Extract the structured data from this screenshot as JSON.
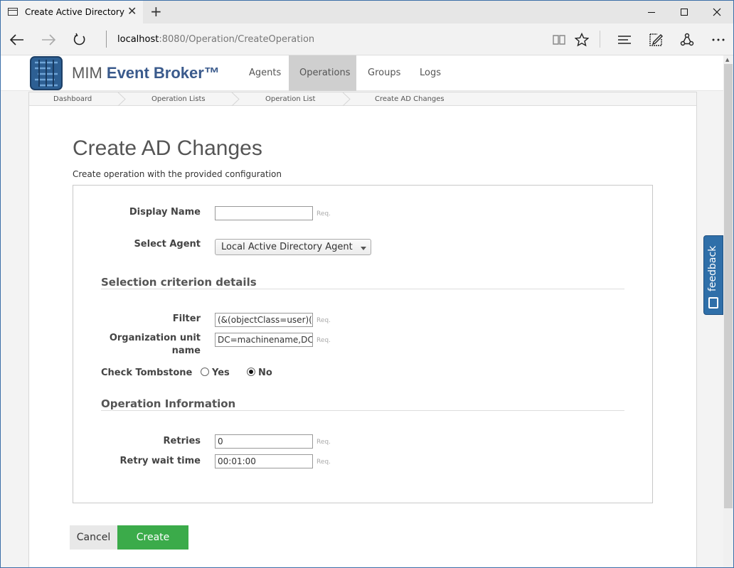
{
  "browser": {
    "tab_title": "Create Active Directory",
    "tab_close": "✕",
    "new_tab": "+",
    "url_host": "localhost",
    "url_rest": ":8080/Operation/CreateOperation"
  },
  "app": {
    "brand_prefix": "MIM",
    "brand_name": "Event Broker™",
    "nav": {
      "agents": "Agents",
      "operations": "Operations",
      "groups": "Groups",
      "logs": "Logs"
    },
    "active_nav": "Operations"
  },
  "breadcrumb": [
    "Dashboard",
    "Operation Lists",
    "Operation List",
    "Create AD Changes"
  ],
  "page": {
    "title": "Create AD Changes",
    "subtitle": "Create operation with the provided configuration"
  },
  "form": {
    "display_name_label": "Display Name",
    "display_name_value": "",
    "req": "Req.",
    "select_agent_label": "Select Agent",
    "select_agent_value": "Local Active Directory Agent",
    "section_selection": "Selection criterion details",
    "filter_label": "Filter",
    "filter_value": "(&(objectClass=user)(obj",
    "ou_label_line1": "Organization unit",
    "ou_label_line2": "name",
    "ou_value": "DC=machinename,DC=lo",
    "tombstone_label": "Check Tombstone",
    "tombstone_yes": "Yes",
    "tombstone_no": "No",
    "tombstone_selected": "No",
    "section_operation": "Operation Information",
    "retries_label": "Retries",
    "retries_value": "0",
    "retry_wait_label": "Retry wait time",
    "retry_wait_value": "00:01:00"
  },
  "actions": {
    "cancel": "Cancel",
    "create": "Create"
  },
  "feedback": {
    "label": "feedback"
  },
  "colors": {
    "create_button": "#3bab4a",
    "feedback_tab": "#2f6fa9",
    "active_nav_bg": "#cfcfcf"
  }
}
